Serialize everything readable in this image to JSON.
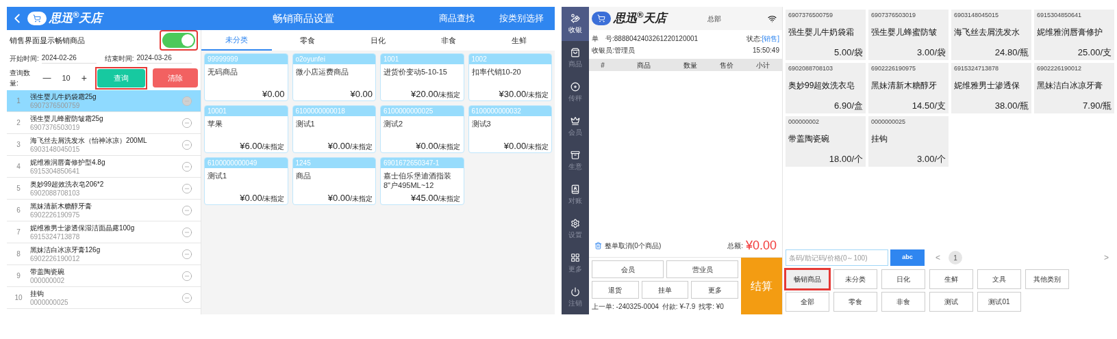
{
  "settings_app": {
    "header": {
      "logo": "思迅$^{®}$天店",
      "title": "畅销商品设置",
      "actions": [
        "商品查找",
        "按类别选择"
      ]
    },
    "toggle": {
      "label": "销售界面显示畅销商品",
      "on": true,
      "highlighted": true
    },
    "start": {
      "label": "开始时间:",
      "value": "2024-02-26"
    },
    "end": {
      "label": "结束时间:",
      "value": "2024-03-26"
    },
    "quantity": {
      "label": "查询数量:",
      "minus": "—",
      "value": "10",
      "plus": "+"
    },
    "query_button": {
      "label": "查询",
      "highlighted": true
    },
    "clear_button": {
      "label": "清除"
    },
    "list": [
      {
        "index": "1",
        "name": "强生婴儿牛奶袋霜25g",
        "code": "6907376500759",
        "selected": true
      },
      {
        "index": "2",
        "name": "强生婴儿蜂蜜防皱霜25g",
        "code": "6907376503019",
        "selected": false
      },
      {
        "index": "3",
        "name": "海飞丝去屑洗发水（怡神冰凉）200ML",
        "code": "6903148045015",
        "selected": false
      },
      {
        "index": "4",
        "name": "妮维雅润唇膏修护型4.8g",
        "code": "6915304850641",
        "selected": false
      },
      {
        "index": "5",
        "name": "奥妙99超效洗衣皂206*2",
        "code": "6902088708103",
        "selected": false
      },
      {
        "index": "6",
        "name": "黑妹清新木糖醇牙膏",
        "code": "6902226190975",
        "selected": false
      },
      {
        "index": "7",
        "name": "妮维雅男士渗透保湿洁面晶露100g",
        "code": "6915324713878",
        "selected": false
      },
      {
        "index": "8",
        "name": "黑妹洁白冰凉牙膏126g",
        "code": "6902226190012",
        "selected": false
      },
      {
        "index": "9",
        "name": "带盖陶瓷碗",
        "code": "000000002",
        "selected": false
      },
      {
        "index": "10",
        "name": "挂钩",
        "code": "0000000025",
        "selected": false
      }
    ],
    "tabs": [
      {
        "label": "未分类",
        "selected": true
      },
      {
        "label": "零食",
        "selected": false
      },
      {
        "label": "日化",
        "selected": false
      },
      {
        "label": "非食",
        "selected": false
      },
      {
        "label": "生鲜",
        "selected": false
      }
    ],
    "cards": [
      {
        "code": "99999999",
        "name": "无码商品",
        "price": "¥0.00"
      },
      {
        "code": "o2oyunfei",
        "name": "微小店运费商品",
        "price": "¥0.00"
      },
      {
        "code": "1001",
        "name": "进货价变动5-10-15",
        "price": "¥20.00",
        "unit": "/未指定"
      },
      {
        "code": "1002",
        "name": "扣率代销10-20",
        "price": "¥30.00",
        "unit": "/未指定"
      },
      {
        "code": "10001",
        "name": "苹果",
        "price": "¥6.00",
        "unit": "/未指定"
      },
      {
        "code": "6100000000018",
        "name": "测试1",
        "price": "¥0.00",
        "unit": "/未指定"
      },
      {
        "code": "6100000000025",
        "name": "测试2",
        "price": "¥0.00",
        "unit": "/未指定"
      },
      {
        "code": "6100000000032",
        "name": "测试3",
        "price": "¥0.00",
        "unit": "/未指定"
      },
      {
        "code": "6100000000049",
        "name": "测试1",
        "price": "¥0.00",
        "unit": "/未指定"
      },
      {
        "code": "1245",
        "name": "商品",
        "price": "¥0.00",
        "unit": "/未指定"
      },
      {
        "code": "6901672650347-1",
        "name": "嘉士伯乐堡迪酒指装8\"户495ML~12",
        "price": "¥45.00",
        "unit": "/未指定"
      }
    ]
  },
  "pos_app": {
    "sidebar": [
      {
        "label": "收银",
        "selected": true
      },
      {
        "label": "商品",
        "selected": false
      },
      {
        "label": "传秤",
        "selected": false
      },
      {
        "label": "会员",
        "selected": false
      },
      {
        "label": "生意",
        "selected": false
      },
      {
        "label": "对账",
        "selected": false
      },
      {
        "label": "设置",
        "selected": false
      },
      {
        "label": "更多",
        "selected": false
      },
      {
        "label": "注销",
        "selected": false
      }
    ],
    "header": {
      "logo": "思迅$^{®}$天店",
      "store": "总部"
    },
    "order": {
      "number_label": "单　号:",
      "number": "8888042403261220120001",
      "status_label": "状态:",
      "status": "[销售]",
      "cashier_label": "收银员:",
      "cashier": "管理员",
      "time": "15:50:49"
    },
    "columns": [
      "#",
      "商品",
      "数量",
      "售价",
      "小计"
    ],
    "cancel": "整单取消(0个商品)",
    "total_label": "总额:",
    "total": "¥0.00",
    "buttons": [
      "会员",
      "营业员",
      "退货",
      "挂单",
      "更多"
    ],
    "checkout": "结算",
    "last_order": [
      "上一单: -240325-0004",
      "付款: ¥-7.9",
      "找零: ¥0"
    ],
    "products": [
      {
        "code": "6907376500759",
        "name": "强生婴儿牛奶袋霜",
        "price": "5.00/袋"
      },
      {
        "code": "6907376503019",
        "name": "强生婴儿蜂蜜防皱",
        "price": "3.00/袋"
      },
      {
        "code": "6903148045015",
        "name": "海飞丝去屑洗发水",
        "price": "24.80/瓶"
      },
      {
        "code": "6915304850641",
        "name": "妮维雅润唇膏修护",
        "price": "25.00/支"
      },
      {
        "code": "6902088708103",
        "name": "奥妙99超效洗衣皂",
        "price": "6.90/盒"
      },
      {
        "code": "6902226190975",
        "name": "黑妹清新木糖醇牙",
        "price": "14.50/支"
      },
      {
        "code": "6915324713878",
        "name": "妮维雅男士渗透保",
        "price": "38.00/瓶"
      },
      {
        "code": "6902226190012",
        "name": "黑妹洁白冰凉牙膏",
        "price": "7.90/瓶"
      },
      {
        "code": "000000002",
        "name": "带盖陶瓷碗",
        "price": "18.00/个"
      },
      {
        "code": "0000000025",
        "name": "挂钩",
        "price": "3.00/个"
      }
    ],
    "search": {
      "placeholder": "条码/助记码/价格(0～100)"
    },
    "keyboard": "abc",
    "prev": "<",
    "page": "1",
    "next": ">",
    "categories": [
      {
        "label": "畅销商品",
        "selected": true,
        "highlighted": true
      },
      {
        "label": "未分类",
        "selected": false,
        "highlighted": false
      },
      {
        "label": "日化",
        "selected": false,
        "highlighted": false
      },
      {
        "label": "生鲜",
        "selected": false,
        "highlighted": false
      },
      {
        "label": "文具",
        "selected": false,
        "highlighted": false
      },
      {
        "label": "其他类别",
        "selected": false,
        "highlighted": false
      },
      {
        "label": "全部",
        "selected": false,
        "highlighted": false
      },
      {
        "label": "零食",
        "selected": false,
        "highlighted": false
      },
      {
        "label": "非食",
        "selected": false,
        "highlighted": false
      },
      {
        "label": "测试",
        "selected": false,
        "highlighted": false
      },
      {
        "label": "测试01",
        "selected": false,
        "highlighted": false
      }
    ]
  }
}
